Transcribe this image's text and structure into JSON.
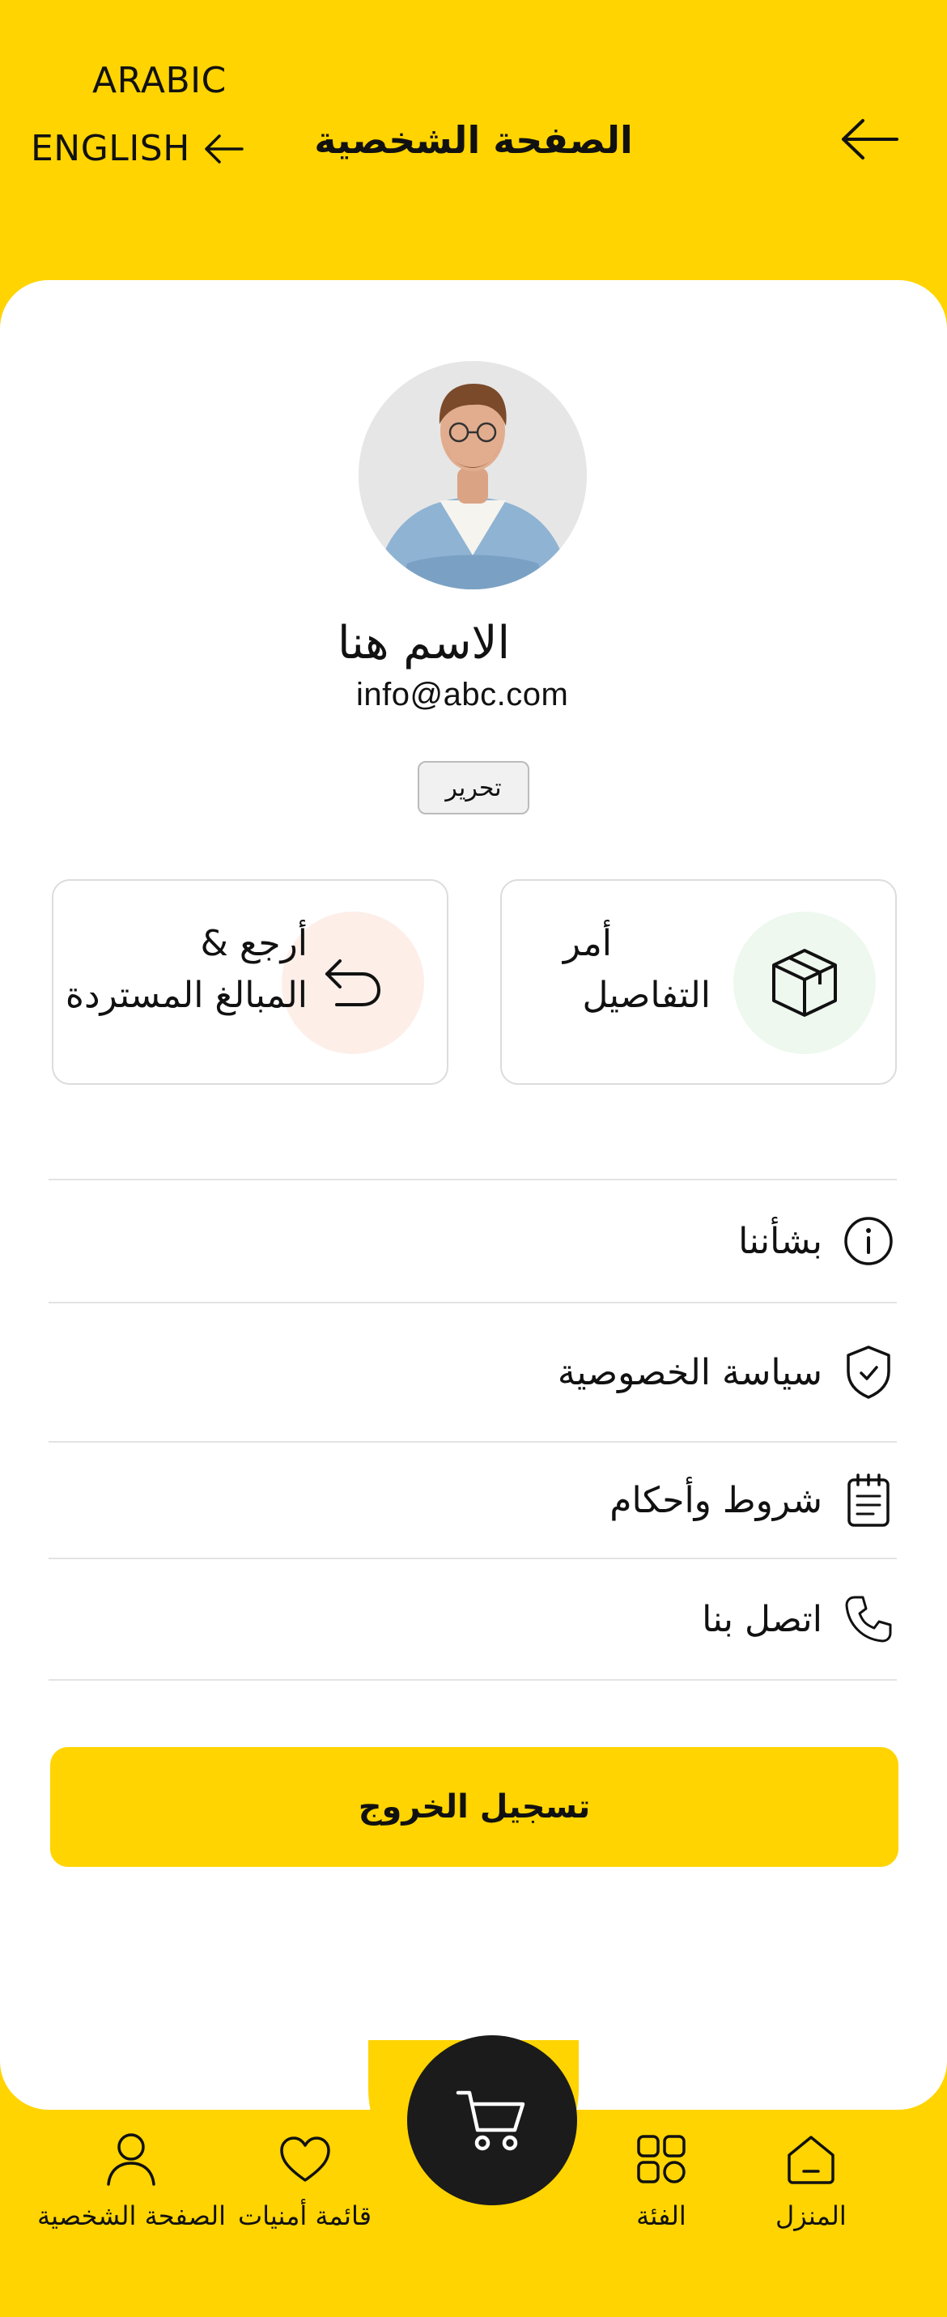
{
  "header": {
    "lang_arabic": "ARABIC",
    "lang_english": "ENGLISH",
    "title": "الصفحة الشخصية"
  },
  "profile": {
    "name": "الاسم هنا",
    "email": "info@abc.com",
    "edit_label": "تحرير"
  },
  "tiles": {
    "returns": {
      "line1": "أرجع &",
      "line2": "المبالغ المستردة"
    },
    "orders": {
      "line1": "أمر",
      "line2": "التفاصيل"
    }
  },
  "menu": [
    {
      "label": "بشأننا",
      "icon": "info-icon"
    },
    {
      "label": "سياسة الخصوصية",
      "icon": "shield-check-icon"
    },
    {
      "label": "شروط وأحكام",
      "icon": "notepad-icon"
    },
    {
      "label": "اتصل بنا",
      "icon": "phone-icon"
    }
  ],
  "logout_label": "تسجيل الخروج",
  "bottom_nav": {
    "home": "المنزل",
    "category": "الفئة",
    "wishlist": "قائمة أمنيات",
    "profile": "الصفحة الشخصية"
  },
  "colors": {
    "accent": "#FFD400",
    "orders_circle": "#EEF8EE",
    "returns_circle": "#FDEEE8",
    "cart_fab": "#1B1B1B"
  }
}
